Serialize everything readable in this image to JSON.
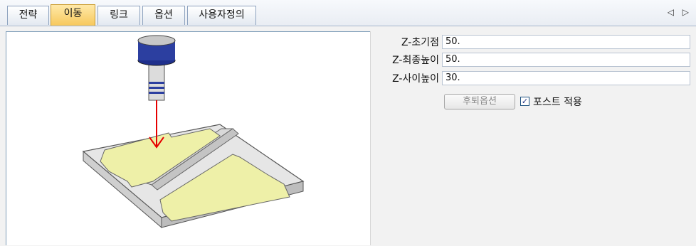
{
  "tabs": [
    {
      "label": "전략",
      "active": false
    },
    {
      "label": "이동",
      "active": true
    },
    {
      "label": "링크",
      "active": false
    },
    {
      "label": "옵션",
      "active": false
    },
    {
      "label": "사용자정의",
      "active": false
    }
  ],
  "tab_scroll_arrows": "◁ ▷",
  "fields": [
    {
      "label": "Z-초기점",
      "value": "50."
    },
    {
      "label": "Z-최종높이",
      "value": "50."
    },
    {
      "label": "Z-사이높이",
      "value": "30."
    }
  ],
  "retract_button": "후퇴옵션",
  "post_apply": {
    "label": "포스트 적용",
    "checked": true,
    "mark": "✓"
  },
  "colors": {
    "active_tab": "#f7c85c",
    "arrow": "#e60000",
    "pocket": "#eef0a8",
    "tool_cap": "#2c3fa0"
  }
}
